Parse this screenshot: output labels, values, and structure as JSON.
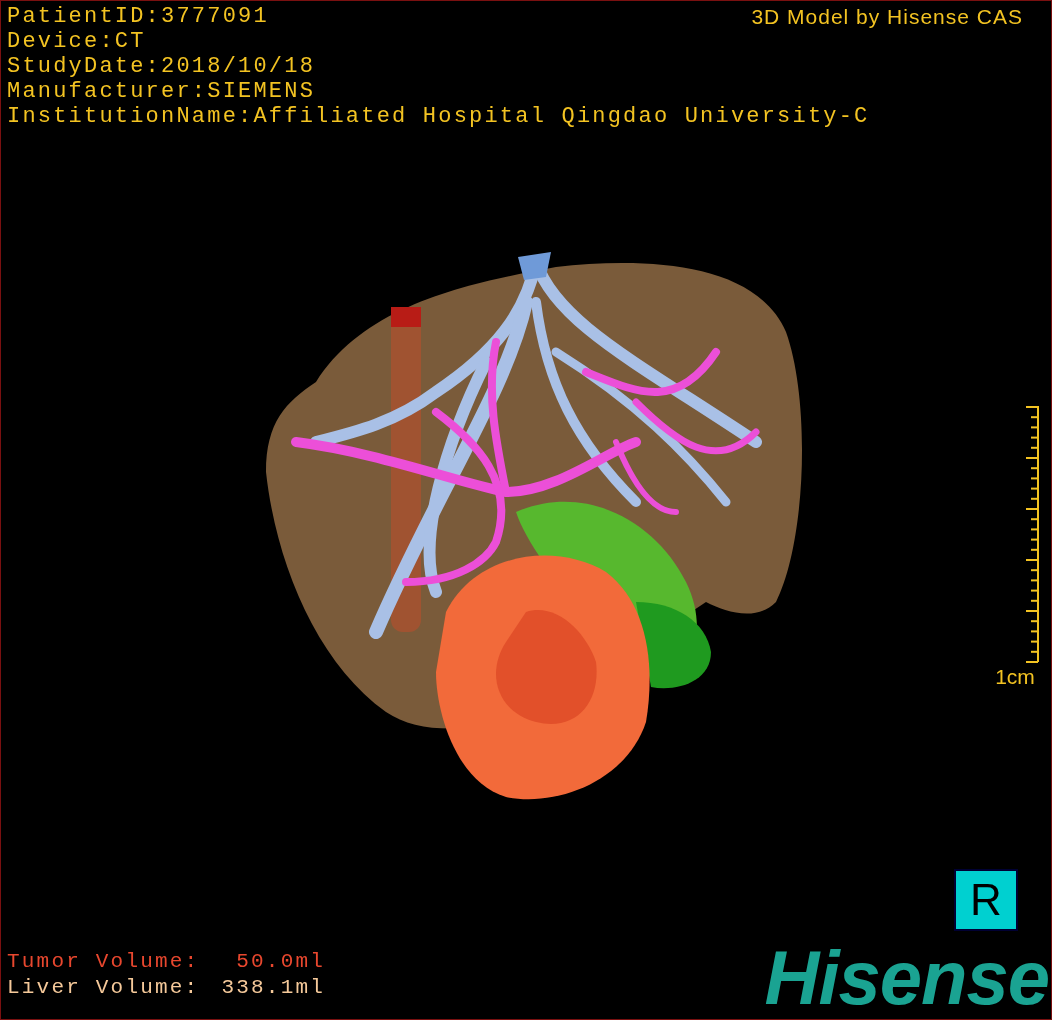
{
  "info_lines": [
    "PatientID:3777091",
    "Device:CT",
    "StudyDate:2018/10/18",
    "Manufacturer:SIEMENS",
    "InstitutionName:Affiliated Hospital Qingdao University-C"
  ],
  "title": "3D Model by Hisense CAS",
  "scale": {
    "label": "1cm"
  },
  "orientation_badge": "R",
  "volumes": [
    {
      "label": "Tumor Volume:",
      "value": "50.0ml",
      "color": "#e8472e"
    },
    {
      "label": "Liver Volume:",
      "value": "338.1ml",
      "color": "#f5c99a"
    }
  ],
  "logo": "Hisense"
}
